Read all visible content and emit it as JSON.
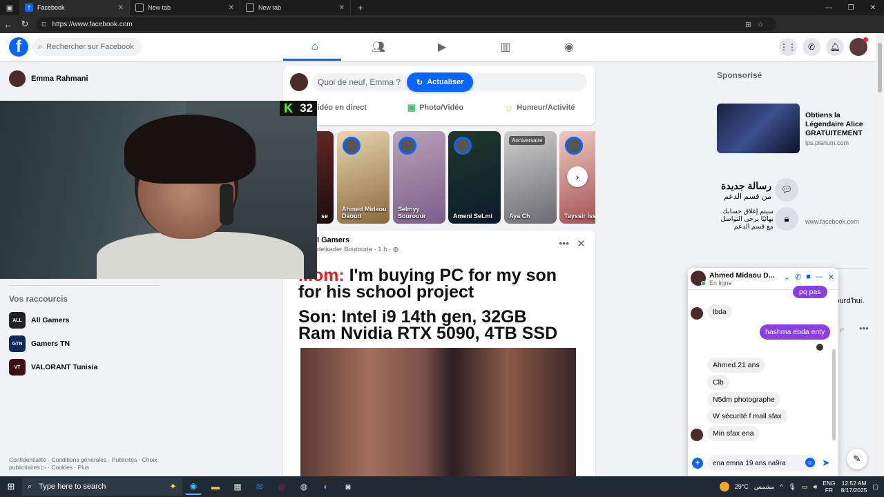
{
  "browser": {
    "tabs": [
      {
        "label": "Facebook",
        "active": true
      },
      {
        "label": "New tab",
        "active": false
      },
      {
        "label": "New tab",
        "active": false
      }
    ],
    "url": "https://www.facebook.com"
  },
  "fb": {
    "search_placeholder": "Rechercher sur Facebook",
    "user_name": "Emma Rahmani"
  },
  "stream_overlay": {
    "platform_icon": "kick-logo",
    "viewer_count": "32"
  },
  "composer": {
    "placeholder": "Quoi de neuf, Emma ?",
    "refresh_label": "Actualiser",
    "actions": [
      "Vidéo en direct",
      "Photo/Vidéo",
      "Humeur/Activité"
    ]
  },
  "stories": [
    {
      "name": "se",
      "badge": ""
    },
    {
      "name": "Ahmed Midaou Daoud",
      "badge": ""
    },
    {
      "name": "Selmyy Sourouur",
      "badge": ""
    },
    {
      "name": "Ameni SeLmi",
      "badge": ""
    },
    {
      "name": "Aya Ch",
      "badge": "Anniversaire"
    },
    {
      "name": "Tayssir Issa",
      "badge": ""
    }
  ],
  "post": {
    "group": "l Gamers",
    "meta": "delkader Boutouria · 1 h · ",
    "meme_mom": "Mom:",
    "meme_line1": " I'm buying PC for my son",
    "meme_line2": "for his school project",
    "meme_line3": "Son: Intel i9 14th gen, 32GB",
    "meme_line4": "Ram Nvidia RTX 5090, 4TB SSD"
  },
  "left": {
    "shortcuts_title": "Vos raccourcis",
    "shortcuts": [
      {
        "label": "All Gamers",
        "thumb": "ALL"
      },
      {
        "label": "Gamers TN",
        "thumb": "GTN"
      },
      {
        "label": "VALORANT Tunisia",
        "thumb": "VT"
      }
    ],
    "footer": "Confidentialité · Conditions générales · Publicités · Choix publicitaires ▷ · Cookies · Plus"
  },
  "right": {
    "sponsored_title": "Sponsorisé",
    "ad1_text": "Obtiens la Légendaire Alice GRATUITEMENT",
    "ad1_url": "lps.plarium.com",
    "ad2_title": "رسالة جديدة",
    "ad2_sub": "من قسم الدعم",
    "ad2_note": "سيتم إغلاق حسابك نهائيًا يرجى التواصل مع قسم الدعم",
    "ad2_url": "www.facebook.com",
    "today_fragment": "jourd'hui."
  },
  "chat": {
    "name": "Ahmed Midaou D...",
    "status": "En ligne",
    "messages": [
      {
        "text": "pq pas",
        "dir": "out"
      },
      {
        "text": "lbda",
        "dir": "in"
      },
      {
        "text": "hashma ebda enty",
        "dir": "out"
      },
      {
        "text": "Ahmed 21 ans",
        "dir": "in"
      },
      {
        "text": "Clb",
        "dir": "in"
      },
      {
        "text": "N5dm photographe",
        "dir": "in"
      },
      {
        "text": "W sécurité f mall sfax",
        "dir": "in"
      },
      {
        "text": "Min sfax ena",
        "dir": "in"
      }
    ],
    "input_value": "ena emna 19 ans na9ra"
  },
  "taskbar": {
    "search_placeholder": "Type here to search",
    "temperature": "29°C",
    "weather_text": "مشمس",
    "lang_line1": "ENG",
    "lang_line2": "FR",
    "time": "12:52 AM",
    "date": "8/17/2025"
  },
  "colors": {
    "fb_blue": "#0866ff",
    "chat_out": "#8c3fe0",
    "kick_green": "#53fc18"
  }
}
